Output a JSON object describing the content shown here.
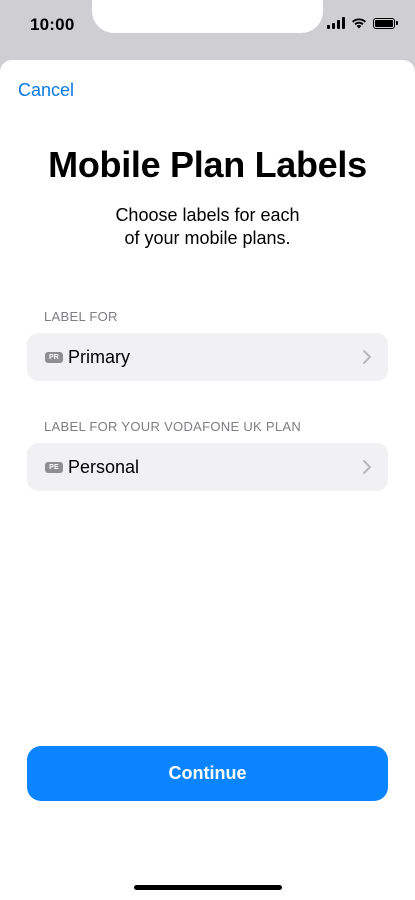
{
  "status_bar": {
    "time": "10:00"
  },
  "nav": {
    "cancel_label": "Cancel"
  },
  "header": {
    "title": "Mobile Plan Labels",
    "subtitle_line1": "Choose labels for each",
    "subtitle_line2": "of your mobile plans."
  },
  "sections": [
    {
      "header": "LABEL FOR",
      "badge": "PR",
      "value": "Primary"
    },
    {
      "header": "LABEL FOR YOUR VODAFONE UK PLAN",
      "badge": "PE",
      "value": "Personal"
    }
  ],
  "footer": {
    "continue_label": "Continue"
  },
  "colors": {
    "accent": "#0a84ff",
    "link": "#0a7ae3",
    "row_background": "#f1f1f3",
    "section_header": "#7d7d82",
    "badge": "#8e8e93"
  },
  "icons": {
    "chevron": "chevron-right-icon",
    "signal": "cellular-signal-icon",
    "wifi": "wifi-icon",
    "battery": "battery-icon"
  }
}
